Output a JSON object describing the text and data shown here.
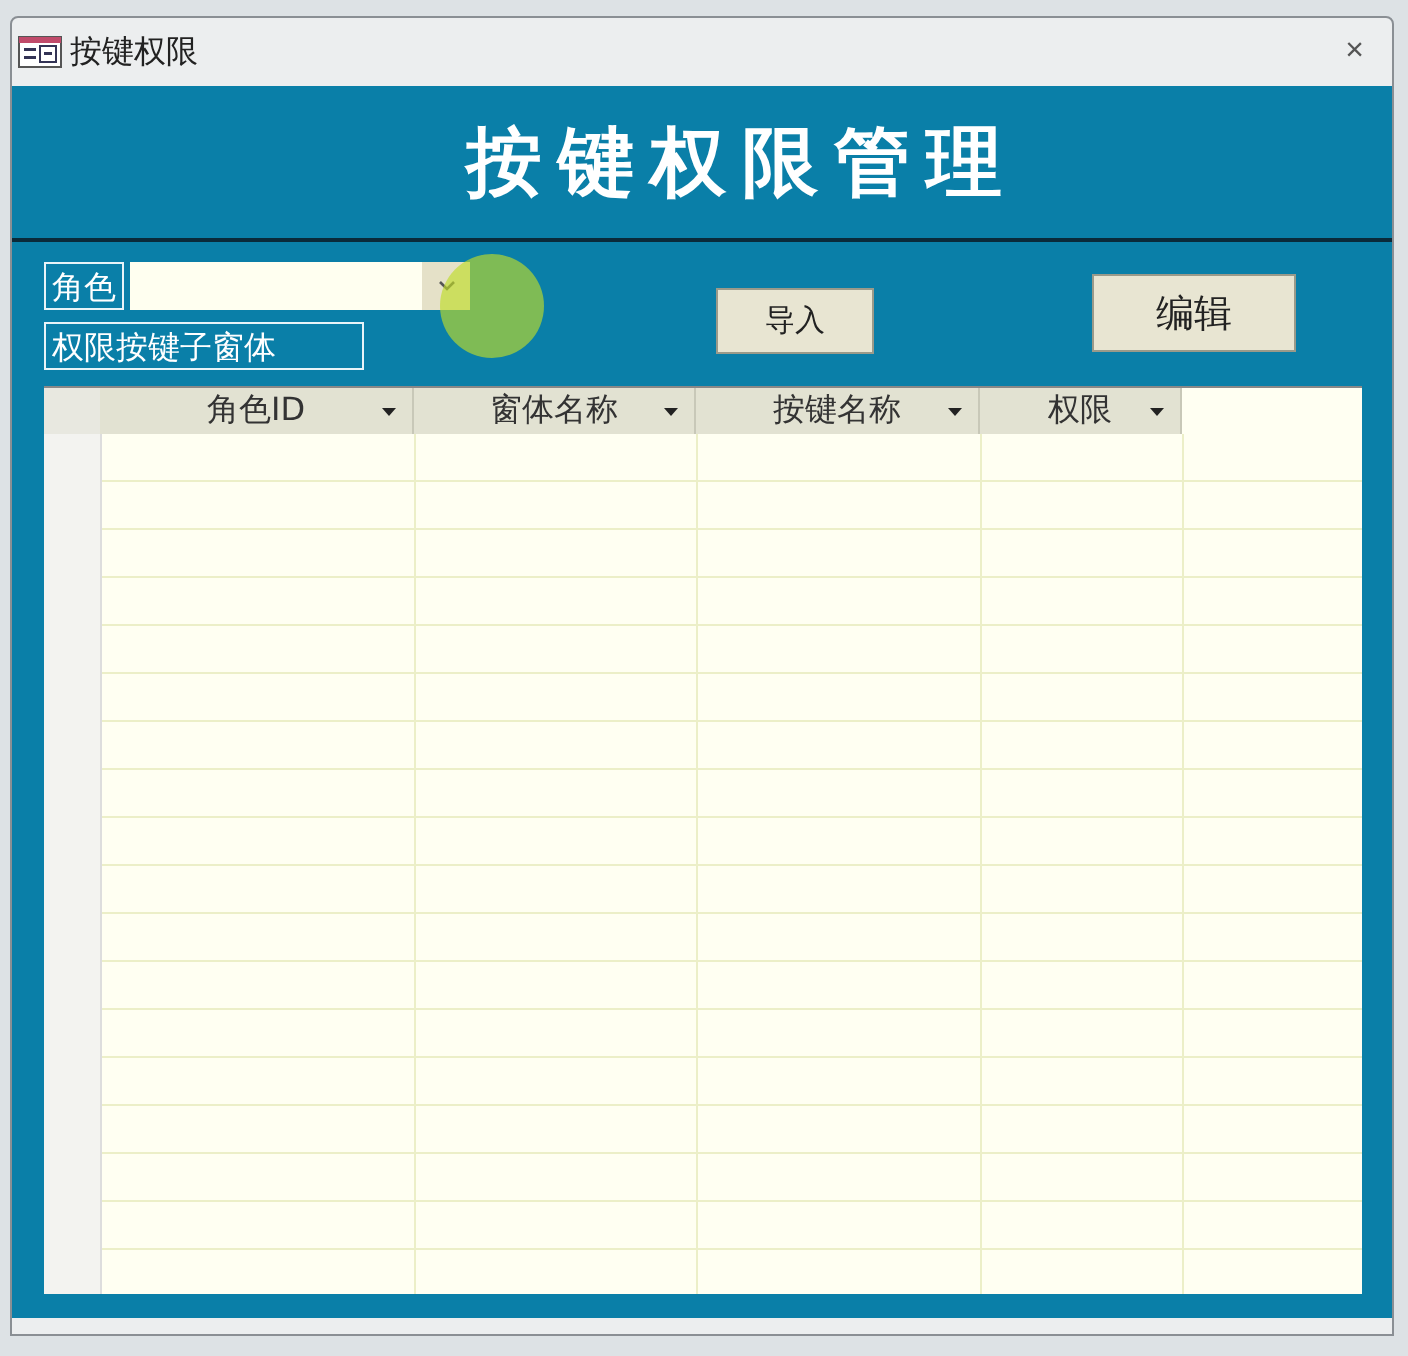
{
  "window": {
    "title": "按键权限",
    "close": "×"
  },
  "header": {
    "title": "按键权限管理"
  },
  "role_field": {
    "label": "角色"
  },
  "subform_label": "权限按键子窗体",
  "buttons": [
    {
      "kind": "import",
      "label": "导入"
    },
    {
      "kind": "edit",
      "label": "编辑"
    }
  ],
  "table": {
    "columns": [
      "角色ID",
      "窗体名称",
      "按键名称",
      "权限"
    ]
  }
}
